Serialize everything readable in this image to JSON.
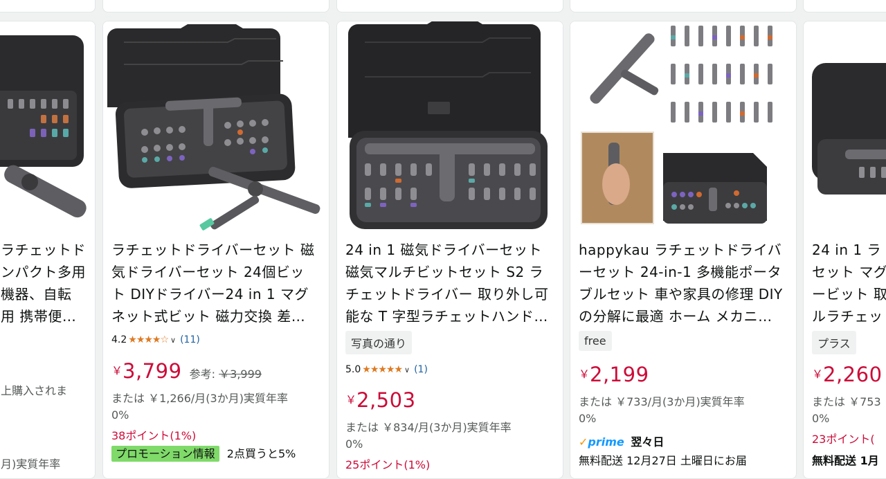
{
  "products": [
    {
      "title_lines": [
        "ラチェットド",
        "ンパクト多用",
        "機器、自転",
        "用 携帯便…"
      ],
      "lines": [
        "上購入されま",
        "",
        "月)実質年率"
      ]
    },
    {
      "title_lines": [
        "ラチェットドライバーセット 磁",
        "気ドライバーセット 24個ビッ",
        "ト DIYドライバー24 in 1 マグ",
        "ネット式ビット 磁力交換 差…"
      ],
      "rating_value": "4.2",
      "stars": "★★★★☆",
      "review_count": "(11)",
      "price_symbol": "￥",
      "price": "3,799",
      "ref_label": "参考:",
      "ref_price": "￥3,999",
      "installment": "または ￥1,266/月(3か月)実質年率",
      "apr": "0%",
      "points": "38ポイント(1%)",
      "promo_tag": "プロモーション情報",
      "promo_text": "2点買うと5%"
    },
    {
      "title_lines": [
        "24 in 1 磁気ドライバーセット",
        "磁気マルチビットセット S2 ラ",
        "チェットドライバー 取り外し可",
        "能な T 字型ラチェットハンド…"
      ],
      "badge": "写真の通り",
      "rating_value": "5.0",
      "stars": "★★★★★",
      "review_count": "(1)",
      "price_symbol": "￥",
      "price": "2,503",
      "installment": "または ￥834/月(3か月)実質年率",
      "apr": "0%",
      "points": "25ポイント(1%)"
    },
    {
      "title_lines": [
        "happykau ラチェットドライバ",
        "ーセット 24-in-1 多機能ポータ",
        "ブルセット 車や家具の修理 DIY",
        "の分解に最適 ホーム メカニ…"
      ],
      "badge": "free",
      "price_symbol": "￥",
      "price": "2,199",
      "installment": "または ￥733/月(3か月)実質年率",
      "apr": "0%",
      "prime_check": "✓",
      "prime_label": "prime",
      "prime_delivery": "翌々日",
      "shipping": "無料配送 12月27日 土曜日にお届"
    },
    {
      "title_lines": [
        "24 in 1 ラ",
        "セット マグ",
        "ービット 取",
        "ルラチェッ"
      ],
      "badge": "プラス",
      "price_symbol": "￥",
      "price": "2,260",
      "installment": "または ￥753",
      "apr": "0%",
      "points": "23ポイント(",
      "shipping": "無料配送 1月"
    }
  ]
}
